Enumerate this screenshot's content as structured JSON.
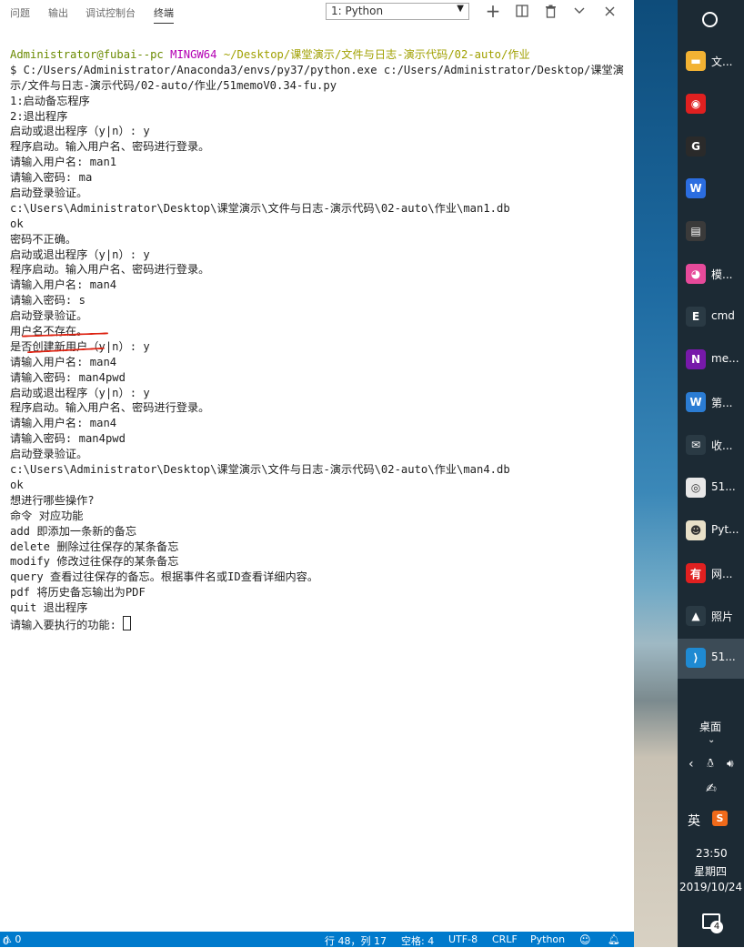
{
  "tabs": [
    "问题",
    "输出",
    "调试控制台",
    "终端"
  ],
  "terminal_select": "1: Python",
  "icons": {
    "add": "plus-icon",
    "split": "split-terminal-icon",
    "trash": "trash-icon",
    "chevron": "chevron-down-icon",
    "close": "close-icon"
  },
  "prompt": {
    "user": "Administrator@fubai--pc",
    "env": "MINGW64",
    "path": "~/Desktop/课堂演示/文件与日志-演示代码/02-auto/作业"
  },
  "cmd_line1": "$ C:/Users/Administrator/Anaconda3/envs/py37/python.exe c:/Users/Administrator/Desktop/课堂演",
  "cmd_line2": "示/文件与日志-演示代码/02-auto/作业/51memoV0.34-fu.py",
  "lines": [
    "1:启动备忘程序",
    "2:退出程序",
    "启动或退出程序（y|n）: y",
    "程序启动。输入用户名、密码进行登录。",
    "请输入用户名: man1",
    "请输入密码: ma",
    "启动登录验证。",
    "c:\\Users\\Administrator\\Desktop\\课堂演示\\文件与日志-演示代码\\02-auto\\作业\\man1.db",
    "ok",
    "密码不正确。",
    "启动或退出程序（y|n）: y",
    "程序启动。输入用户名、密码进行登录。",
    "请输入用户名: man4",
    "请输入密码: s",
    "启动登录验证。",
    "用户名不存在。",
    "是否创建新用户（y|n）: y",
    "请输入用户名: man4",
    "请输入密码: man4pwd",
    "启动或退出程序（y|n）: y",
    "程序启动。输入用户名、密码进行登录。",
    "请输入用户名: man4",
    "请输入密码: man4pwd",
    "启动登录验证。",
    "c:\\Users\\Administrator\\Desktop\\课堂演示\\文件与日志-演示代码\\02-auto\\作业\\man4.db",
    "ok",
    "想进行哪些操作?",
    "命令 对应功能",
    "add 即添加一条新的备忘",
    "delete 删除过往保存的某条备忘",
    "modify 修改过往保存的某条备忘",
    "query 查看过往保存的备忘。根据事件名或ID查看详细内容。",
    "pdf 将历史备忘输出为PDF",
    "quit 退出程序"
  ],
  "input_prompt": "请输入要执行的功能:",
  "status": {
    "problems": "0",
    "warnings": "0",
    "position": "行 48，列 17",
    "spaces": "空格: 4",
    "encoding": "UTF-8",
    "eol": "CRLF",
    "language": "Python"
  },
  "taskbar": {
    "items": [
      {
        "label": "文...",
        "icon": "folder-icon",
        "color": "#f2b233"
      },
      {
        "label": "",
        "icon": "netease-music-icon",
        "color": "#e02020"
      },
      {
        "label": "",
        "icon": "g-app-icon",
        "color": "#2a2a2a"
      },
      {
        "label": "",
        "icon": "shield-w-icon",
        "color": "#2b6de0"
      },
      {
        "label": "",
        "icon": "python-file-icon",
        "color": "#3a3a3a"
      },
      {
        "label": "模...",
        "icon": "colorful-app-icon",
        "color": "#e64a9a"
      },
      {
        "label": "cmd",
        "icon": "terminal-icon",
        "color": "#2a3a44"
      },
      {
        "label": "me...",
        "icon": "onenote-icon",
        "color": "#7719aa"
      },
      {
        "label": "第...",
        "icon": "word-icon",
        "color": "#2b7cd3"
      },
      {
        "label": "收...",
        "icon": "mail-icon",
        "color": "#2a3a44"
      },
      {
        "label": "51...",
        "icon": "chrome-icon",
        "color": "#e8e8e8"
      },
      {
        "label": "Pyt...",
        "icon": "python-icon",
        "color": "#e8e0c8"
      },
      {
        "label": "网...",
        "icon": "youdao-icon",
        "color": "#e02020"
      },
      {
        "label": "照片",
        "icon": "photos-icon",
        "color": "#2a3a44"
      },
      {
        "label": "51...",
        "icon": "vscode-icon",
        "color": "#1f8ad2"
      }
    ],
    "desktop": "桌面",
    "ime": "英",
    "time": "23:50",
    "weekday": "星期四",
    "date": "2019/10/24",
    "notifications": "4"
  }
}
